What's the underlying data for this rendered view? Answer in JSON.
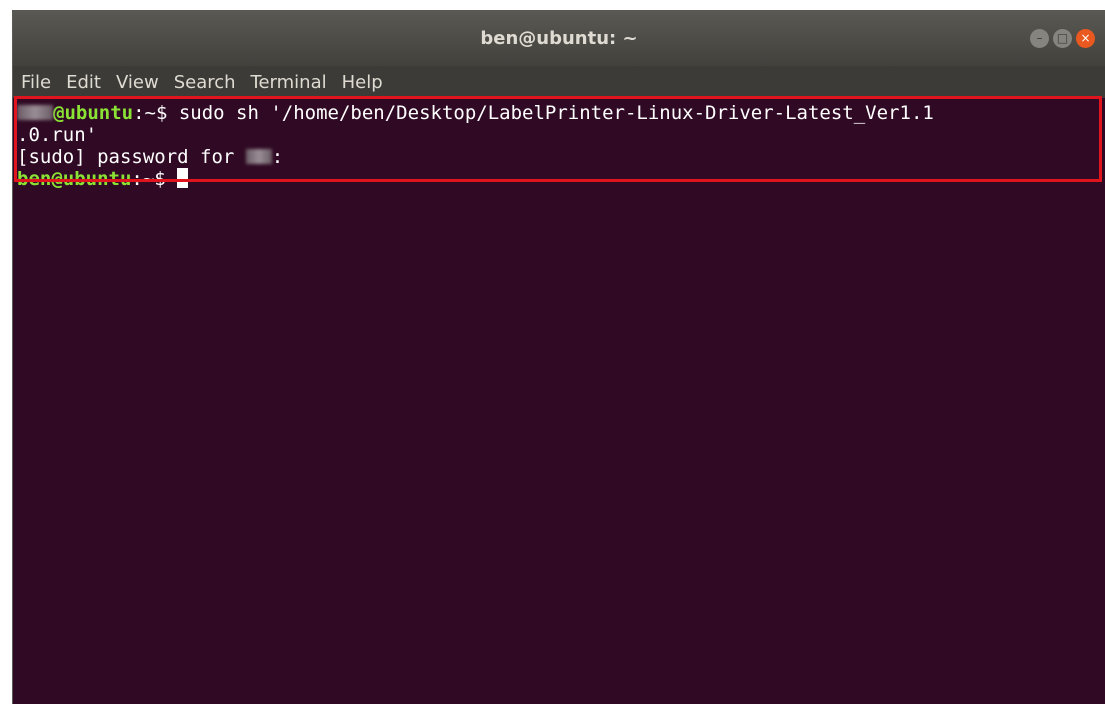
{
  "window": {
    "title": "ben@ubuntu: ~",
    "controls": {
      "minimize": "–",
      "maximize": "□",
      "close": "×"
    }
  },
  "menu": {
    "items": [
      "File",
      "Edit",
      "View",
      "Search",
      "Terminal",
      "Help"
    ]
  },
  "terminal": {
    "line1": {
      "prompt_user": "@ubuntu",
      "prompt_path": ":~$",
      "command": " sudo sh '/home/ben/Desktop/LabelPrinter-Linux-Driver-Latest_Ver1.1"
    },
    "line2": ".0.run'",
    "line3": {
      "text": "[sudo] password for ",
      "suffix": ":"
    },
    "line4": {
      "prompt_user": "ben@ubuntu",
      "prompt_path": ":~$",
      "spacer": " "
    }
  },
  "colors": {
    "terminal_bg": "#300a24",
    "prompt_user": "#8ae234",
    "prompt_path": "#729fcf",
    "highlight": "#e0141c",
    "close_button": "#e9591f"
  }
}
